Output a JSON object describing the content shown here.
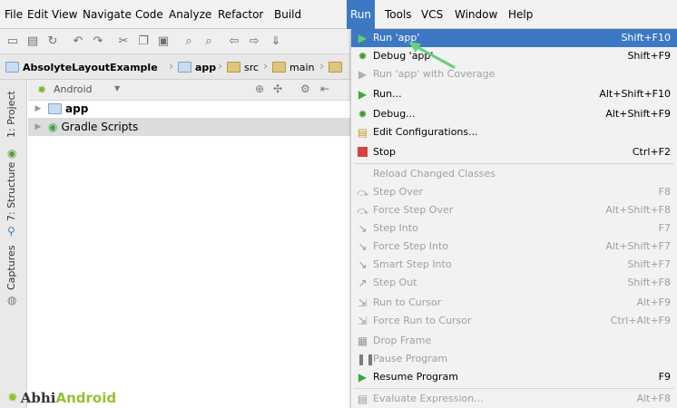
{
  "menubar": {
    "items": [
      "File",
      "Edit",
      "View",
      "Navigate",
      "Code",
      "Analyze",
      "Refactor",
      "Build",
      "Run",
      "Tools",
      "VCS",
      "Window",
      "Help"
    ],
    "active": "Run"
  },
  "breadcrumb": {
    "items": [
      "AbsolyteLayoutExample",
      "app",
      "src",
      "main"
    ]
  },
  "side_tabs": {
    "project": "1: Project",
    "structure": "7: Structure",
    "captures": "Captures"
  },
  "project_panel": {
    "view_selector": "Android",
    "tree": [
      {
        "label": "app"
      },
      {
        "label": "Gradle Scripts"
      }
    ]
  },
  "run_menu": {
    "items": [
      {
        "label": "Run 'app'",
        "shortcut": "Shift+F10",
        "icon": "run-icon",
        "enabled": true,
        "selected": true
      },
      {
        "label": "Debug 'app'",
        "shortcut": "Shift+F9",
        "icon": "debug-icon",
        "enabled": true
      },
      {
        "label": "Run 'app' with Coverage",
        "shortcut": "",
        "icon": "coverage-icon",
        "enabled": false
      },
      {
        "label": "Run...",
        "shortcut": "Alt+Shift+F10",
        "icon": "run-icon",
        "enabled": true
      },
      {
        "label": "Debug...",
        "shortcut": "Alt+Shift+F9",
        "icon": "debug-icon",
        "enabled": true
      },
      {
        "label": "Edit Configurations...",
        "shortcut": "",
        "icon": "edit-config-icon",
        "enabled": true
      },
      {
        "label": "Stop",
        "shortcut": "Ctrl+F2",
        "icon": "stop-icon",
        "enabled": true
      },
      {
        "label": "Reload Changed Classes",
        "shortcut": "",
        "icon": "",
        "enabled": false
      },
      {
        "label": "Step Over",
        "shortcut": "F8",
        "icon": "step-over-icon",
        "enabled": false
      },
      {
        "label": "Force Step Over",
        "shortcut": "Alt+Shift+F8",
        "icon": "force-step-over-icon",
        "enabled": false
      },
      {
        "label": "Step Into",
        "shortcut": "F7",
        "icon": "step-into-icon",
        "enabled": false
      },
      {
        "label": "Force Step Into",
        "shortcut": "Alt+Shift+F7",
        "icon": "force-step-into-icon",
        "enabled": false
      },
      {
        "label": "Smart Step Into",
        "shortcut": "Shift+F7",
        "icon": "smart-step-into-icon",
        "enabled": false
      },
      {
        "label": "Step Out",
        "shortcut": "Shift+F8",
        "icon": "step-out-icon",
        "enabled": false
      },
      {
        "label": "Run to Cursor",
        "shortcut": "Alt+F9",
        "icon": "run-to-cursor-icon",
        "enabled": false
      },
      {
        "label": "Force Run to Cursor",
        "shortcut": "Ctrl+Alt+F9",
        "icon": "force-run-to-cursor-icon",
        "enabled": false
      },
      {
        "label": "Drop Frame",
        "shortcut": "",
        "icon": "drop-frame-icon",
        "enabled": false
      },
      {
        "label": "Pause Program",
        "shortcut": "",
        "icon": "pause-icon",
        "enabled": false
      },
      {
        "label": "Resume Program",
        "shortcut": "F9",
        "icon": "resume-icon",
        "enabled": true
      },
      {
        "label": "Evaluate Expression...",
        "shortcut": "Alt+F8",
        "icon": "evaluate-icon",
        "enabled": false
      }
    ]
  },
  "watermark": {
    "brand": "Abhi",
    "accent": "Android"
  },
  "colors": {
    "selection": "#3c78c3",
    "run_green": "#3aa83a",
    "stop_red": "#d9413a",
    "arrow_green": "#67d07a",
    "brand_green": "#96c12f"
  }
}
